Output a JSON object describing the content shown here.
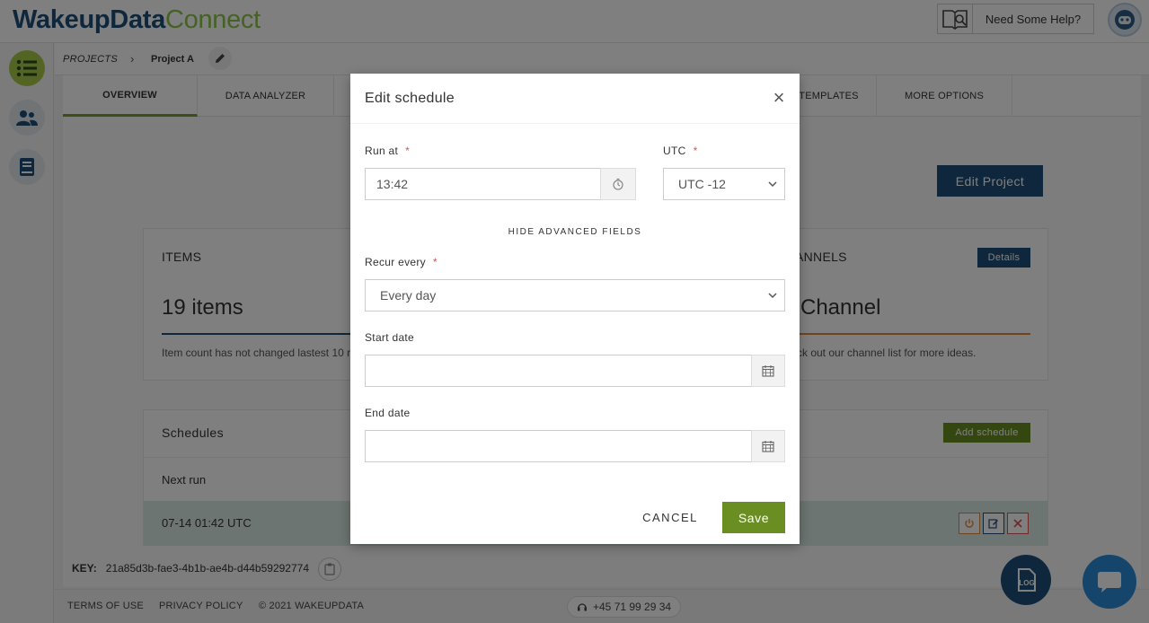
{
  "app": {
    "logo_part1": "WakeupData",
    "logo_part2": "Connect"
  },
  "header": {
    "help_label": "Need Some Help?"
  },
  "breadcrumb": {
    "projects": "PROJECTS",
    "project": "Project A"
  },
  "tabs": [
    {
      "label": "OVERVIEW"
    },
    {
      "label": "DATA ANALYZER"
    },
    {
      "label": "TEMPLATES"
    },
    {
      "label": "MORE OPTIONS"
    }
  ],
  "main": {
    "edit_project_label": "Edit Project",
    "items_card": {
      "title": "ITEMS",
      "count": "19 items",
      "note": "Item count has not changed lastest 10 r"
    },
    "channels_card": {
      "title": "ANNELS",
      "details_label": "Details",
      "value": "Channel",
      "note": "ck out our channel list for more ideas."
    },
    "schedules_card": {
      "title": "Schedules",
      "add_label": "Add schedule",
      "col_next_run": "Next run",
      "row_next_run": "07-14 01:42 UTC"
    },
    "key": {
      "label": "KEY:",
      "value": "21a85d3b-fae3-4b1b-ae4b-d44b59292774"
    }
  },
  "footer": {
    "terms": "TERMS OF USE",
    "privacy": "PRIVACY POLICY",
    "copyright": "© 2021 WAKEUPDATA",
    "phone": "+45 71 99 29 34"
  },
  "modal": {
    "title": "Edit schedule",
    "run_at_label": "Run at",
    "run_at_value": "13:42",
    "required_mark": "*",
    "utc_label": "UTC",
    "utc_value": "UTC -12",
    "advanced_toggle": "HIDE ADVANCED FIELDS",
    "recur_label": "Recur every",
    "recur_value": "Every day",
    "start_label": "Start date",
    "start_value": "",
    "end_label": "End date",
    "end_value": "",
    "cancel_label": "CANCEL",
    "save_label": "Save"
  },
  "colors": {
    "brand_blue": "#1f4e79",
    "brand_green": "#8bc34a",
    "save_green": "#6b8e23",
    "required_red": "#d9534f"
  },
  "icons": {
    "help": "book-search-icon",
    "avatar": "robot-avatar-icon",
    "sidebar": [
      "list-icon",
      "users-icon",
      "book-icon"
    ],
    "time": "clock-icon",
    "date": "calendar-icon",
    "close": "close-icon",
    "log": "log-icon",
    "chat": "chat-icon"
  }
}
